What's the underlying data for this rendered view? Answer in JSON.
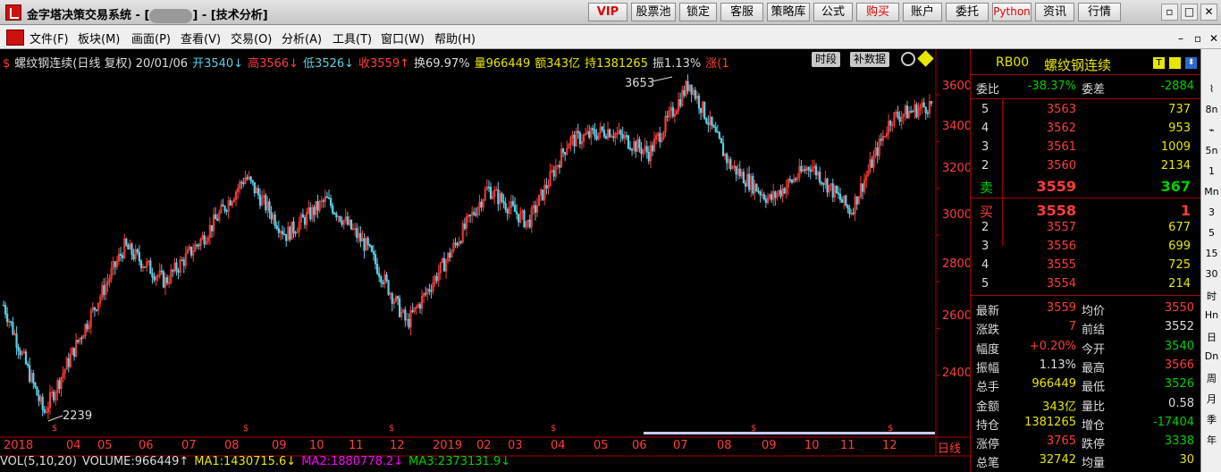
{
  "title_bar": {
    "app_title": "金字塔决策交易系统 - [",
    "app_title_suffix": "] - [技术分析]",
    "buttons": [
      "VIP",
      "股票池",
      "锁定",
      "客服",
      "策略库",
      "公式",
      "购买",
      "账户",
      "委托",
      "Python",
      "资讯",
      "行情"
    ],
    "window_controls": [
      "▫",
      "□",
      "✕"
    ]
  },
  "menu_bar": {
    "items": [
      "文件(F)",
      "板块(M)",
      "画面(P)",
      "查看(V)",
      "交易(O)",
      "分析(A)",
      "工具(T)",
      "窗口(W)",
      "帮助(H)"
    ],
    "window_controls": [
      "–",
      "▫",
      "✕"
    ]
  },
  "chart_header": {
    "name": "螺纹钢连续(日线 复权) 20/01/06",
    "open_label": "开3540↓",
    "high_label": "高3566↓",
    "low_label": "低3526↓",
    "close_label": "收3559↑",
    "turnover_label": "换69.97%",
    "volume_label": "量966449",
    "amount_label": "额343亿",
    "position_label": "持1381265",
    "amplitude_label": "振1.13%",
    "change_label": "涨(1",
    "btn_period": "时段",
    "btn_supplement": "补数据"
  },
  "chart_annotations": {
    "peak": "3653",
    "trough": "2239"
  },
  "chart_data": {
    "type": "candlestick",
    "x_labels": [
      "2018",
      "04",
      "05",
      "06",
      "07",
      "08",
      "09",
      "10",
      "11",
      "12",
      "2019",
      "02",
      "03",
      "04",
      "05",
      "06",
      "07",
      "08",
      "09",
      "10",
      "11",
      "12",
      "日线"
    ],
    "y_ticks": [
      2400,
      2600,
      2800,
      3000,
      3200,
      3400,
      3600
    ],
    "ylim": [
      2200,
      3680
    ],
    "keypoints": [
      {
        "date": "2018-01",
        "price": 2700
      },
      {
        "date": "2018-03",
        "price": 2239
      },
      {
        "date": "2018-04",
        "price": 2600
      },
      {
        "date": "2018-05",
        "price": 2950
      },
      {
        "date": "2018-06",
        "price": 2800
      },
      {
        "date": "2018-07",
        "price": 3000
      },
      {
        "date": "2018-08",
        "price": 3250
      },
      {
        "date": "2018-09",
        "price": 3000
      },
      {
        "date": "2018-10",
        "price": 3150
      },
      {
        "date": "2018-11",
        "price": 2950
      },
      {
        "date": "2018-12",
        "price": 2620
      },
      {
        "date": "2019-01",
        "price": 2900
      },
      {
        "date": "2019-02",
        "price": 3200
      },
      {
        "date": "2019-03",
        "price": 3050
      },
      {
        "date": "2019-04",
        "price": 3400
      },
      {
        "date": "2019-05",
        "price": 3450
      },
      {
        "date": "2019-06",
        "price": 3350
      },
      {
        "date": "2019-07",
        "price": 3653
      },
      {
        "date": "2019-08",
        "price": 3300
      },
      {
        "date": "2019-09",
        "price": 3150
      },
      {
        "date": "2019-10",
        "price": 3300
      },
      {
        "date": "2019-11",
        "price": 3100
      },
      {
        "date": "2019-12",
        "price": 3500
      },
      {
        "date": "2020-01",
        "price": 3559
      }
    ],
    "volume_indicator": {
      "label": "VOL(5,10,20)",
      "volume": "VOLUME:966449↑",
      "ma1": "MA1:1430715.6↓",
      "ma2": "MA2:1880778.2↓",
      "ma3": "MA3:2373131.9↓"
    }
  },
  "quote_panel": {
    "code": "RB00",
    "name": "螺纹钢连续",
    "commission_ratio": {
      "label": "委比",
      "value": "-38.37%",
      "label2": "委差",
      "value2": "-2884"
    },
    "asks": [
      {
        "level": "5",
        "price": "3563",
        "vol": "737"
      },
      {
        "level": "4",
        "price": "3562",
        "vol": "953"
      },
      {
        "level": "3",
        "price": "3561",
        "vol": "1009"
      },
      {
        "level": "2",
        "price": "3560",
        "vol": "2134"
      },
      {
        "level": "卖",
        "price": "3559",
        "vol": "367"
      }
    ],
    "bids": [
      {
        "level": "买",
        "price": "3558",
        "vol": "1"
      },
      {
        "level": "2",
        "price": "3557",
        "vol": "677"
      },
      {
        "level": "3",
        "price": "3556",
        "vol": "699"
      },
      {
        "level": "4",
        "price": "3555",
        "vol": "725"
      },
      {
        "level": "5",
        "price": "3554",
        "vol": "214"
      }
    ],
    "stats": [
      {
        "l": "最新",
        "v": "3559",
        "l2": "均价",
        "v2": "3550"
      },
      {
        "l": "涨跌",
        "v": "7",
        "l2": "前结",
        "v2": "3552"
      },
      {
        "l": "幅度",
        "v": "+0.20%",
        "l2": "今开",
        "v2": "3540"
      },
      {
        "l": "振幅",
        "v": "1.13%",
        "l2": "最高",
        "v2": "3566"
      },
      {
        "l": "总手",
        "v": "966449",
        "l2": "最低",
        "v2": "3526"
      },
      {
        "l": "金额",
        "v": "343亿",
        "l2": "量比",
        "v2": "0.58"
      },
      {
        "l": "持仓",
        "v": "1381265",
        "l2": "增仓",
        "v2": "-17404"
      },
      {
        "l": "涨停",
        "v": "3765",
        "l2": "跌停",
        "v2": "3338"
      },
      {
        "l": "总笔",
        "v": "32742",
        "l2": "均量",
        "v2": "30"
      }
    ]
  },
  "side_toolbar": [
    "⌇",
    "8n",
    "⌁",
    "5n",
    "1",
    "Mn",
    "3",
    "5",
    "15",
    "30",
    "时",
    "Hn",
    "日",
    "Dn",
    "周",
    "月",
    "季",
    "年"
  ],
  "colors": {
    "up": "#ff3c3c",
    "down": "#5cd0e6",
    "accent": "#e6e600",
    "panel_border": "#aa0000"
  }
}
